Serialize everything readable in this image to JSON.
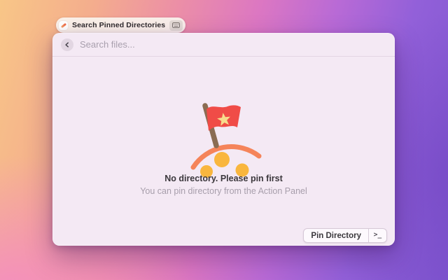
{
  "desktop": {
    "wallpaper_colors": {
      "left_top": "#f8c687",
      "left_bottom": "#f088c8",
      "middle": "#dc77c2",
      "right": "#7f55cf"
    }
  },
  "command_pill": {
    "label": "Search Pinned Directories",
    "app_icon": "pencil-icon",
    "hotkey_icon": "keyboard-icon"
  },
  "window": {
    "search": {
      "placeholder": "Search files...",
      "back_icon": "chevron-left"
    },
    "empty_state": {
      "title": "No directory. Please pin first",
      "subtitle": "You can pin directory from the Action Panel",
      "illustration": {
        "name": "flag-on-mound-illustration",
        "flag_color": "#f04c47",
        "star_color": "#f7dc8c",
        "pole_color": "#8a6c52",
        "arc_color": "#f5845a",
        "coin_color": "#f9b63e"
      }
    },
    "footer": {
      "primary_action_label": "Pin Directory",
      "action_panel_glyph": ">_",
      "action_panel_icon": "terminal-prompt-icon"
    }
  }
}
